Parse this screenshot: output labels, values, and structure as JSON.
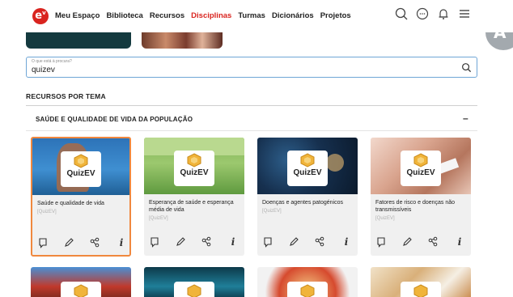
{
  "nav": {
    "logo_text": "e",
    "links": [
      "Meu Espaço",
      "Biblioteca",
      "Recursos",
      "Disciplinas",
      "Turmas",
      "Dicionários",
      "Projetos"
    ],
    "active_index": 3,
    "icons": [
      "search-icon",
      "chat-icon",
      "bell-icon",
      "menu-icon"
    ],
    "brand_color": "#d9241f"
  },
  "corner_avatar": "A",
  "search": {
    "placeholder": "O que está à procura?",
    "value": "quizev"
  },
  "section": {
    "title": "RECURSOS POR TEMA"
  },
  "theme": {
    "title": "SAÚDE E QUALIDADE DE VIDA DA POPULAÇÃO",
    "toggle": "–"
  },
  "cards": [
    {
      "badge": "QuizEV",
      "title": "Saúde e qualidade de vida",
      "type": "[QuizEV]",
      "selected": true
    },
    {
      "badge": "QuizEV",
      "title": "Esperança de saúde e esperança média de vida",
      "type": "[QuizEV]",
      "selected": false
    },
    {
      "badge": "QuizEV",
      "title": "Doenças e agentes patogénicos",
      "type": "[QuizEV]",
      "selected": false
    },
    {
      "badge": "QuizEV",
      "title": "Fatores de risco e doenças não transmissíveis",
      "type": "[QuizEV]",
      "selected": false
    }
  ],
  "card_actions": [
    "bookmark-icon",
    "edit-icon",
    "share-icon",
    "info-icon"
  ],
  "accent_selected": "#f0883e"
}
